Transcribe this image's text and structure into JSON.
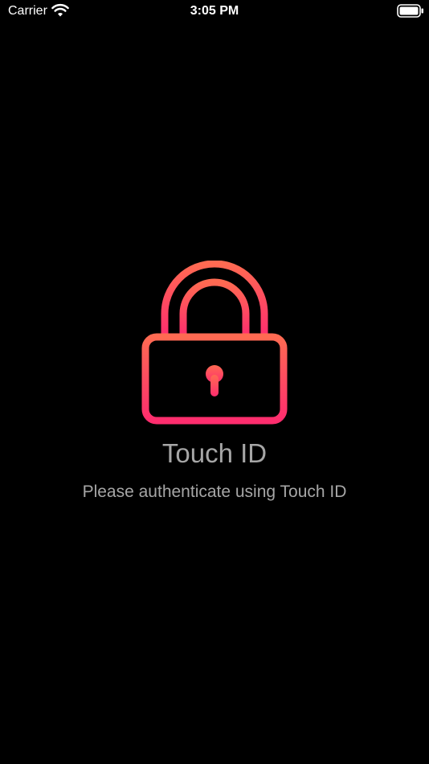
{
  "status_bar": {
    "carrier": "Carrier",
    "time": "3:05 PM",
    "wifi_icon": "wifi-icon",
    "battery_icon": "battery-icon"
  },
  "main": {
    "lock_icon": "lock-icon",
    "title": "Touch ID",
    "subtitle": "Please authenticate using Touch ID"
  },
  "colors": {
    "background": "#000000",
    "lock_gradient_top": "#ff6a52",
    "lock_gradient_bottom": "#ff2d6e",
    "text": "#a6a6a6"
  }
}
